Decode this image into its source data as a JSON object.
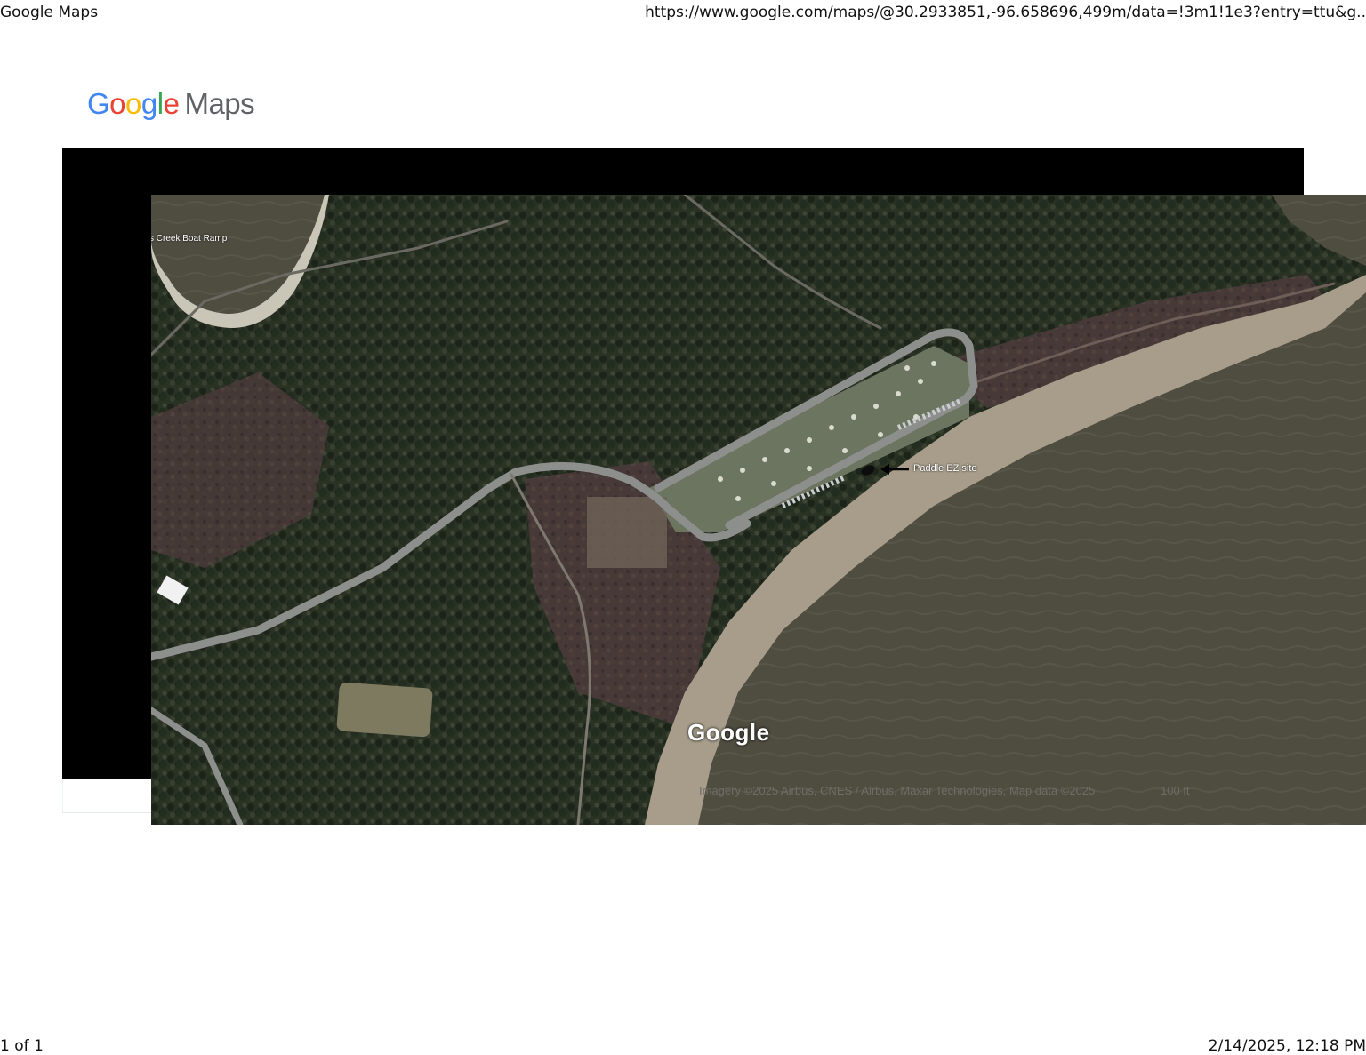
{
  "print_header": {
    "title": "Google Maps",
    "url": "https://www.google.com/maps/@30.2933851,-96.658696,499m/data=!3m1!1e3?entry=ttu&g.."
  },
  "logo": {
    "google": [
      "G",
      "o",
      "o",
      "g",
      "l",
      "e"
    ],
    "google_colors": [
      "#4285F4",
      "#EA4335",
      "#FBBC05",
      "#4285F4",
      "#34A853",
      "#EA4335"
    ],
    "maps": "Maps"
  },
  "map": {
    "type": "satellite",
    "place_label": "s Creek Boat Ramp",
    "annotation": "Paddle EZ site",
    "watermark": "Google",
    "attribution": "Imagery ©2025 Airbus, CNES / Airbus, Maxar Technologies, Map data ©2025",
    "scale": "100 ft"
  },
  "print_footer": {
    "page": "1 of 1",
    "datetime": "2/14/2025, 12:18 PM"
  }
}
